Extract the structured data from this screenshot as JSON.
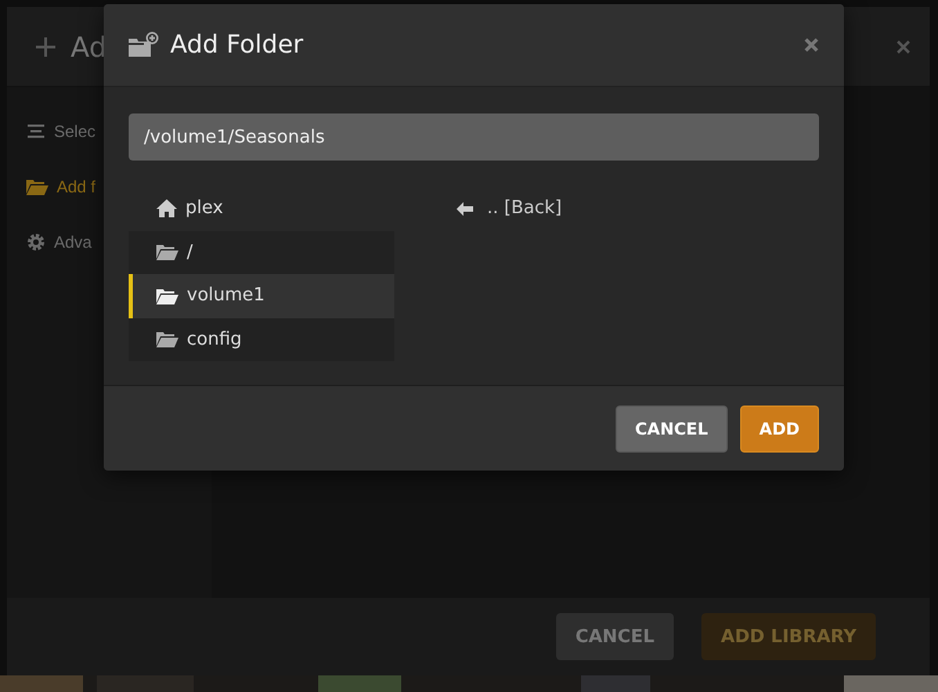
{
  "background_dialog": {
    "title": "Ad",
    "sidebar": [
      {
        "label": "Selec",
        "kind": "list",
        "selected": false
      },
      {
        "label": "Add f",
        "kind": "folder",
        "selected": true
      },
      {
        "label": "Adva",
        "kind": "gear",
        "selected": false
      }
    ],
    "buttons": [
      {
        "label": "CANCEL",
        "disabled": false
      },
      {
        "label": "ADD LIBRARY",
        "disabled": true
      }
    ]
  },
  "dialog": {
    "title": "Add Folder",
    "path": "/volume1/Seasonals",
    "places": [
      {
        "label": "plex",
        "kind": "home",
        "selected": false
      },
      {
        "label": "/",
        "kind": "folder",
        "selected": false
      },
      {
        "label": "volume1",
        "kind": "folder",
        "selected": true
      },
      {
        "label": "config",
        "kind": "folder",
        "selected": false
      }
    ],
    "entries": [
      {
        "label": ".. [Back]",
        "kind": "back"
      }
    ],
    "buttons": [
      {
        "label": "CANCEL",
        "kind": "secondary"
      },
      {
        "label": "ADD",
        "kind": "primary"
      }
    ]
  }
}
